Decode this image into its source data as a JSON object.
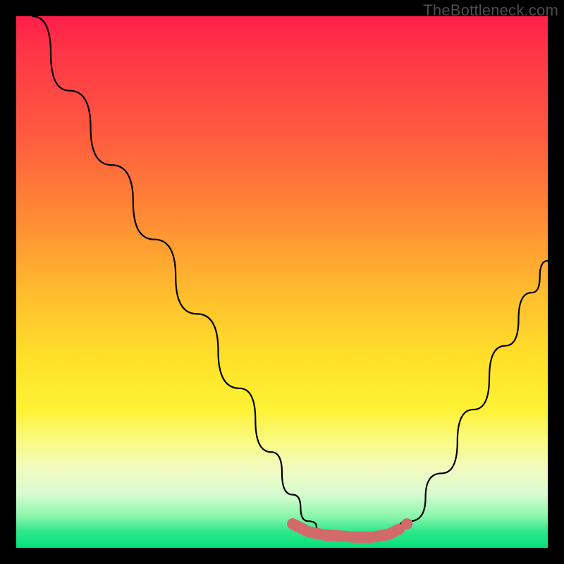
{
  "watermark": "TheBottleneck.com",
  "gradient_colors": {
    "top": "#ff1e4a",
    "mid_orange": "#ff8b34",
    "mid_yellow": "#ffe22a",
    "pale": "#f2fbc0",
    "bottom": "#07df7c"
  },
  "curve_stroke": "#000000",
  "marker_stroke": "#d36a6a",
  "chart_data": {
    "type": "line",
    "title": "",
    "xlabel": "",
    "ylabel": "",
    "xlim": [
      0,
      100
    ],
    "ylim": [
      0,
      100
    ],
    "grid": false,
    "legend": null,
    "series": [
      {
        "name": "bottleneck-curve",
        "x": [
          3,
          10,
          18,
          26,
          34,
          42,
          48,
          52,
          55,
          58,
          61,
          64,
          67,
          70,
          74,
          80,
          86,
          92,
          97,
          100
        ],
        "y": [
          100,
          86,
          72,
          58,
          44,
          30,
          18,
          10,
          5,
          2.8,
          2.2,
          2.0,
          2.0,
          2.5,
          5,
          14,
          26,
          38,
          48,
          54
        ]
      }
    ],
    "annotations": [
      {
        "name": "valley-band",
        "x": [
          52,
          55,
          58,
          61,
          64,
          67,
          70,
          72
        ],
        "y": [
          4.5,
          3.0,
          2.4,
          2.2,
          2.0,
          2.0,
          2.5,
          3.5
        ]
      }
    ]
  }
}
